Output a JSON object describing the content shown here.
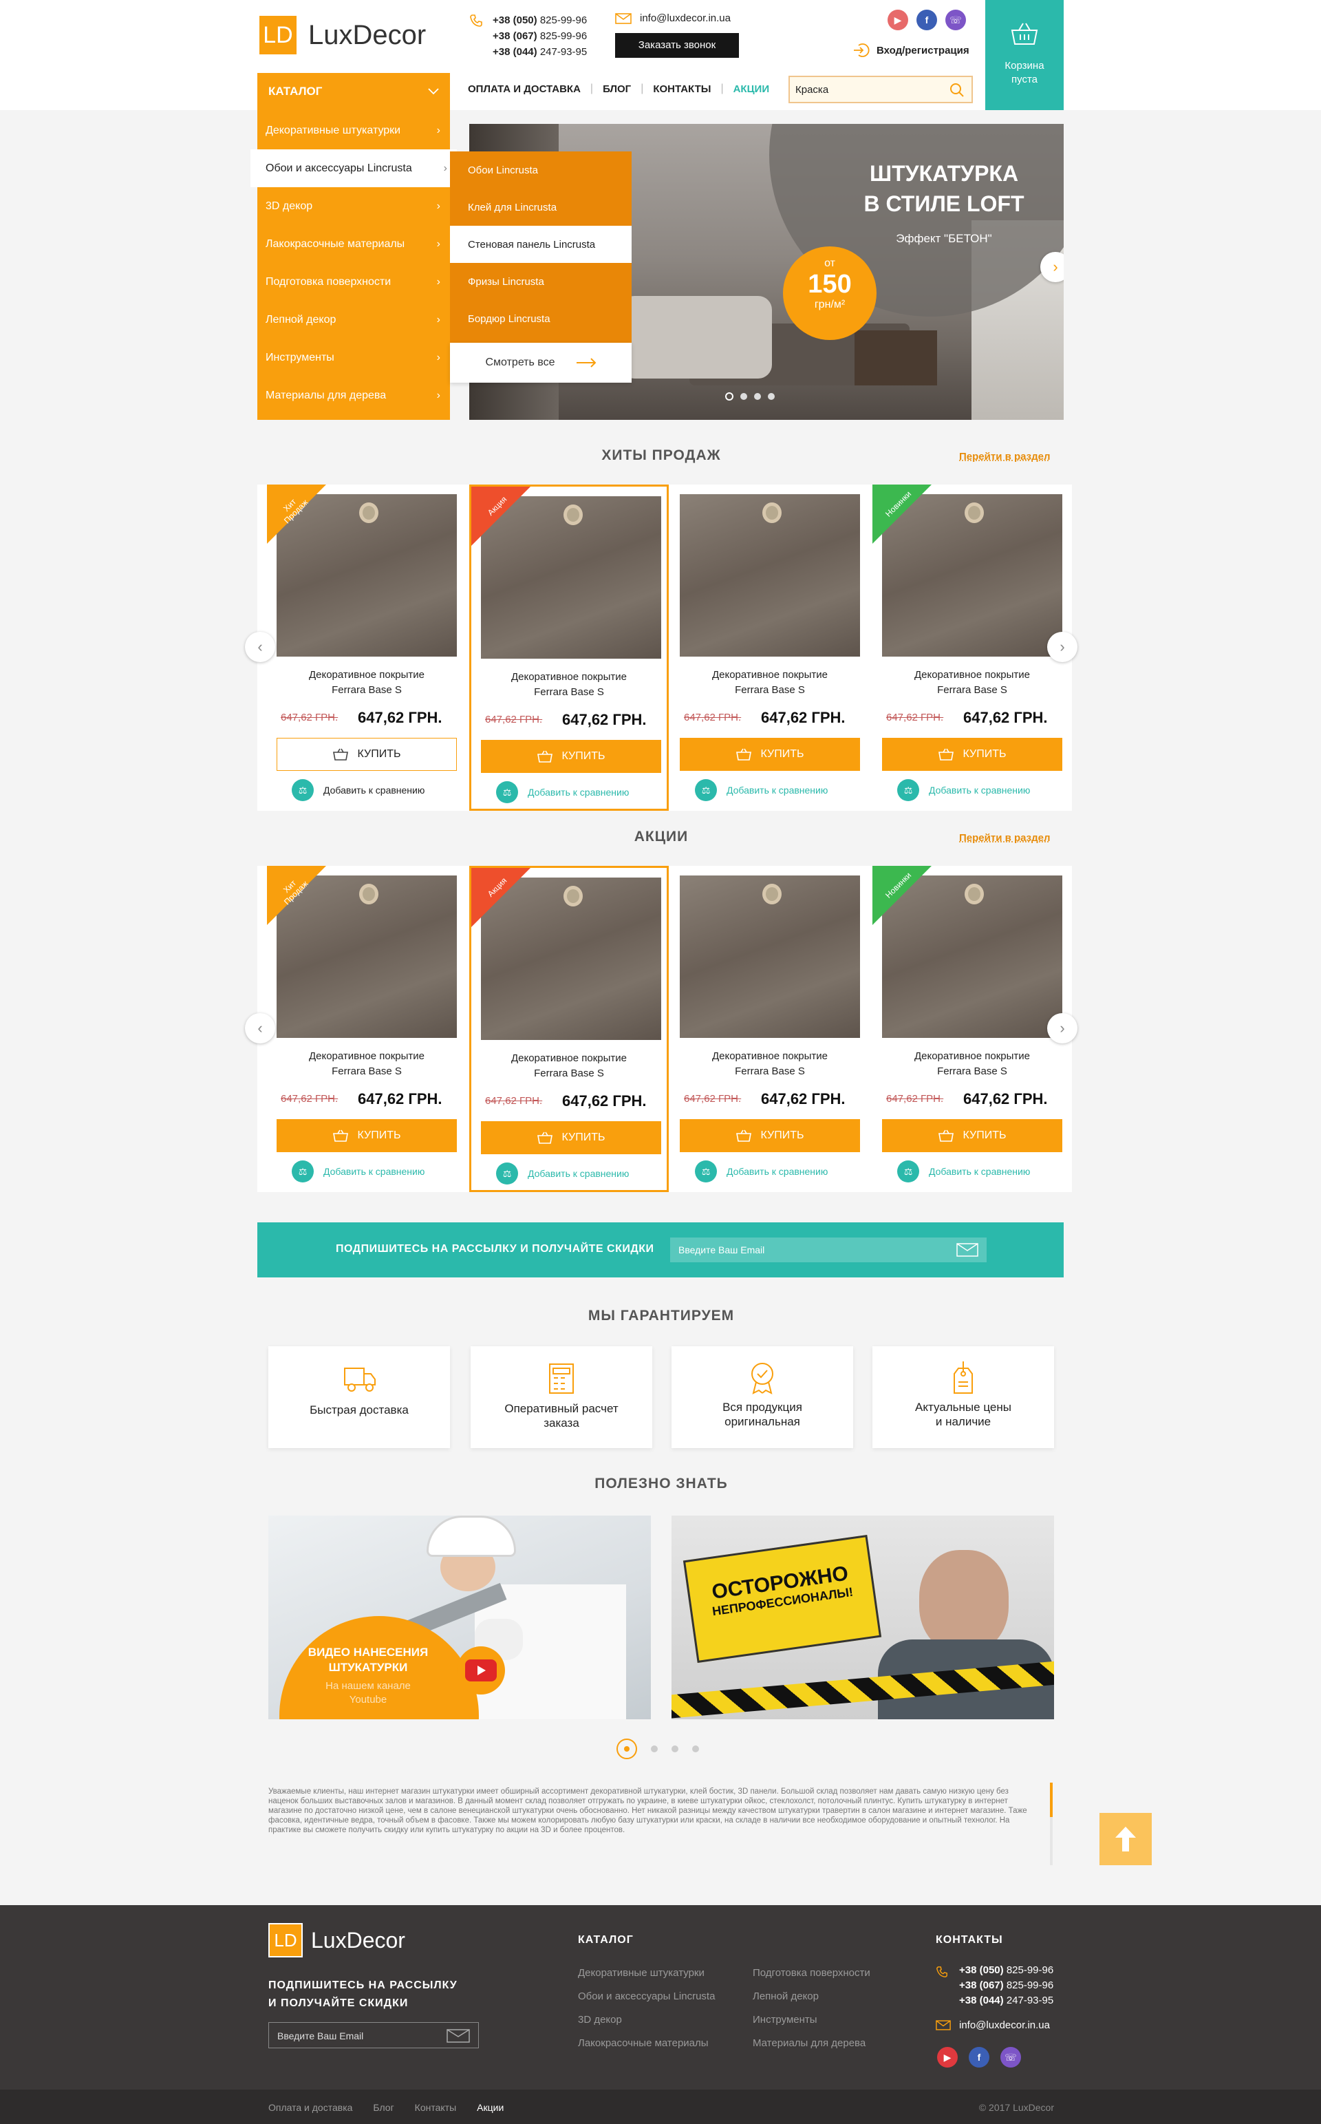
{
  "brand": {
    "logo_mark": "LD",
    "name": "LuxDecor"
  },
  "header": {
    "phones": [
      {
        "code": "+38 (050)",
        "num": "825-99-96"
      },
      {
        "code": "+38 (067)",
        "num": "825-99-96"
      },
      {
        "code": "+38 (044)",
        "num": "247-93-95"
      }
    ],
    "email": "info@luxdecor.in.ua",
    "call_button": "Заказать звонок",
    "login": "Вход/регистрация",
    "cart_line1": "Корзина",
    "cart_line2": "пуста",
    "social_colors": {
      "youtube": "#e76a6a",
      "facebook": "#3b5fb5",
      "viber": "#7d55c7"
    }
  },
  "nav": {
    "items": [
      "ОПЛАТА И ДОСТАВКА",
      "БЛОГ",
      "КОНТАКТЫ",
      "АКЦИИ"
    ]
  },
  "search": {
    "value": "Краска"
  },
  "catalog": {
    "title": "КАТАЛОГ",
    "items": [
      "Декоративные штукатурки",
      "Обои и аксессуары Lincrusta",
      "3D декор",
      "Лакокрасочные материалы",
      "Подготовка поверхности",
      "Лепной декор",
      "Инструменты",
      "Материалы для дерева"
    ],
    "submenu": [
      "Обои Lincrusta",
      "Клей для Lincrusta",
      "Стеновая панель Lincrusta",
      "Фризы Lincrusta",
      "Бордюр Lincrusta"
    ],
    "see_all": "Смотреть все"
  },
  "hero": {
    "title_line1": "ШТУКАТУРКА",
    "title_line2": "В СТИЛЕ LOFT",
    "subtitle": "Эффект \"БЕТОН\"",
    "price_from": "от",
    "price": "150",
    "price_unit": "грн/м²"
  },
  "hits": {
    "title": "ХИТЫ ПРОДАЖ",
    "link": "Перейти в раздел"
  },
  "promo": {
    "title": "АКЦИИ",
    "link": "Перейти в раздел"
  },
  "product": {
    "name_line1": "Декоративное покрытие",
    "name_line2": "Ferrara Base S",
    "old_price": "647,62 ГРН.",
    "price": "647,62 ГРН.",
    "buy": "КУПИТЬ",
    "compare": "Добавить к сравнению"
  },
  "badges": {
    "hit": "Хит Продаж",
    "sale": "Акция",
    "new": "Новинки"
  },
  "badge_colors": {
    "hit": "#f99f0d",
    "sale": "#ee4f2c",
    "new": "#3cb84f"
  },
  "newsletter": {
    "text": "ПОДПИШИТЕСЬ НА РАССЫЛКУ И ПОЛУЧАЙТЕ СКИДКИ",
    "placeholder": "Введите Ваш Email"
  },
  "guarantee": {
    "title": "МЫ ГАРАНТИРУЕМ",
    "items": [
      {
        "l1": "Быстрая доставка",
        "l2": ""
      },
      {
        "l1": "Оперативный расчет",
        "l2": "заказа"
      },
      {
        "l1": "Вся продукция",
        "l2": "оригинальная"
      },
      {
        "l1": "Актуальные цены",
        "l2": "и наличие"
      }
    ]
  },
  "useful": {
    "title": "ПОЛЕЗНО ЗНАТЬ",
    "video_l1": "ВИДЕО НАНЕСЕНИЯ",
    "video_l2": "ШТУКАТУРКИ",
    "video_sub1": "На нашем канале",
    "video_sub2": "Youtube",
    "warn_l1": "ОСТОРОЖНО",
    "warn_l2": "НЕПРОФЕССИОНАЛЫ!"
  },
  "about_text": "Уважаемые клиенты, наш интернет магазин штукатурки имеет обширный ассортимент декоративной штукатурки, клей бостик, 3D панели. Большой склад позволяет нам давать самую низкую цену без наценок больших выставочных залов и магазинов. В данный момент склад позволяет отгружать по украине, в киеве штукатурки ойкос, стеклохолст, потолочный плинтус. Купить штукатурку в интернет магазине по достаточно низкой цене, чем в салоне венецианской штукатурки очень обоснованно. Нет никакой разницы между качеством штукатурки травертин в салон магазине и интернет магазине. Таже фасовка, идентичные ведра, точный объем в фасовке. Также мы можем колорировать любую базу штукатурки или краски, на складе в наличии все необходимое оборудование и опытный технолог. На практике вы сможете получить скидку или купить штукатурку по акции на 3D и более процентов.",
  "footer": {
    "subscribe_l1": "ПОДПИШИТЕСЬ НА РАССЫЛКУ",
    "subscribe_l2": "И ПОЛУЧАЙТЕ СКИДКИ",
    "placeholder": "Введите Ваш Email",
    "catalog_title": "КАТАЛОГ",
    "catalog_col1": [
      "Декоративные штукатурки",
      "Обои и аксессуары Lincrusta",
      "3D декор",
      "Лакокрасочные материалы"
    ],
    "catalog_col2": [
      "Подготовка поверхности",
      "Лепной декор",
      "Инструменты",
      "Материалы для дерева"
    ],
    "contacts_title": "КОНТАКТЫ",
    "bottom_links": [
      "Оплата и доставка",
      "Блог",
      "Контакты",
      "Акции"
    ],
    "copyright": "© 2017 LuxDecor"
  },
  "colors": {
    "accent": "#f99f0d",
    "teal": "#2bb9ab",
    "dark": "#3b3838"
  }
}
